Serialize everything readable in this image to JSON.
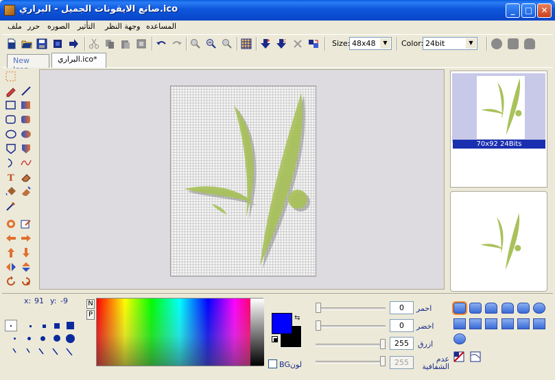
{
  "window": {
    "title": "صانع الايقونات الجميل - البراري.ico",
    "minimize": "_",
    "maximize": "□",
    "close": "✕"
  },
  "menu": [
    "ملف",
    "حرر",
    "الصوره",
    "التأثير",
    "وجهة النظر",
    "المساعده"
  ],
  "toolbar": {
    "size_label": "Size:",
    "size_value": "48x48",
    "color_label": "Color:",
    "color_value": "24bit"
  },
  "tabs": [
    {
      "label": "New Icon",
      "active": false
    },
    {
      "label": "البراري.ico*",
      "active": true
    }
  ],
  "preview": {
    "caption": "70x92 24Bits"
  },
  "status": {
    "x_label": "x:",
    "x_value": "91",
    "y_label": "y:",
    "y_value": "-9"
  },
  "palette_buttons": {
    "n": "N",
    "p": "P"
  },
  "colors": {
    "foreground": "#0000ff",
    "background": "#000000",
    "bg_label": "BGلون"
  },
  "sliders": [
    {
      "label": "احمر",
      "value": "0"
    },
    {
      "label": "اخضر",
      "value": "0"
    },
    {
      "label": "ازرق",
      "value": "255"
    },
    {
      "label": "عدم الشفافية",
      "value": "255"
    }
  ],
  "icons": {
    "app": "app-icon",
    "logo_color": "#a8c84a"
  }
}
